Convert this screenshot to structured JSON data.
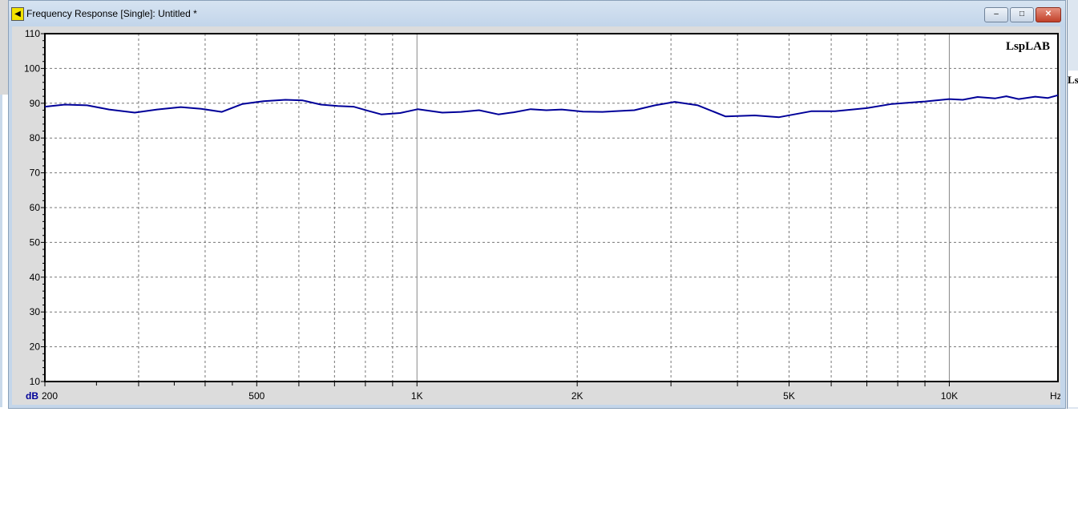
{
  "window": {
    "title": "Frequency Response [Single]: Untitled *",
    "min_label": "–",
    "max_label": "□",
    "close_label": "✕"
  },
  "right_window": {
    "logo_fragment": "Lsp"
  },
  "chart_data": {
    "type": "line",
    "title": "",
    "watermark": "LspLAB",
    "xlabel": "Hz",
    "ylabel": "dB",
    "xscale": "log",
    "xlim": [
      200,
      16000
    ],
    "ylim": [
      10,
      110
    ],
    "grid": true,
    "yticks": [
      10,
      20,
      30,
      40,
      50,
      60,
      70,
      80,
      90,
      100,
      110
    ],
    "xtick_labels": [
      {
        "f": 200,
        "label": "200"
      },
      {
        "f": 500,
        "label": "500"
      },
      {
        "f": 1000,
        "label": "1K"
      },
      {
        "f": 2000,
        "label": "2K"
      },
      {
        "f": 5000,
        "label": "5K"
      },
      {
        "f": 10000,
        "label": "10K"
      }
    ],
    "series": [
      {
        "name": "Frequency Response",
        "color": "#000099",
        "x": [
          200,
          218,
          240,
          264,
          295,
          325,
          360,
          393,
          430,
          470,
          515,
          566,
          610,
          660,
          710,
          760,
          810,
          857,
          930,
          1004,
          1116,
          1210,
          1308,
          1422,
          1520,
          1635,
          1750,
          1870,
          2050,
          2230,
          2560,
          2800,
          3050,
          3370,
          3800,
          4310,
          4790,
          5500,
          6100,
          7000,
          7800,
          9000,
          10000,
          10600,
          11300,
          12200,
          12800,
          13500,
          14500,
          15300,
          16000
        ],
        "y": [
          89.0,
          89.6,
          89.4,
          88.2,
          87.3,
          88.2,
          88.9,
          88.4,
          87.5,
          89.8,
          90.6,
          91.0,
          90.8,
          89.6,
          89.2,
          89.0,
          87.8,
          86.8,
          87.2,
          88.3,
          87.3,
          87.5,
          88.0,
          86.8,
          87.4,
          88.3,
          88.0,
          88.2,
          87.6,
          87.5,
          88.0,
          89.4,
          90.4,
          89.4,
          86.2,
          86.5,
          86.0,
          87.7,
          87.7,
          88.6,
          89.8,
          90.5,
          91.2,
          91.0,
          91.8,
          91.4,
          92.0,
          91.2,
          91.9,
          91.5,
          92.3
        ]
      }
    ]
  }
}
